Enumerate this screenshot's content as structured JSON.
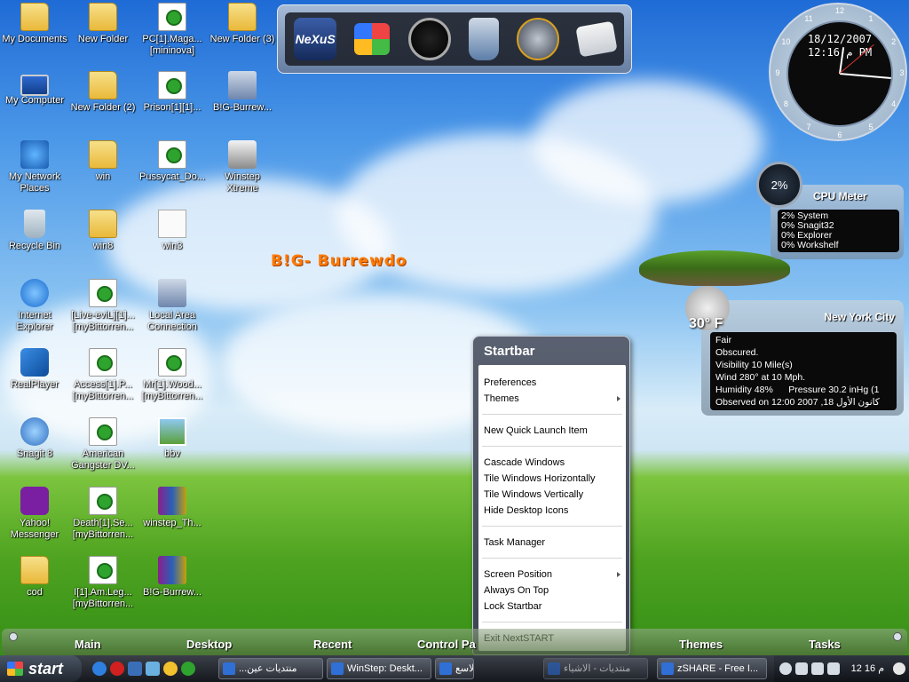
{
  "desktop": {
    "icons": [
      {
        "label": "My Documents",
        "icon": "folder-icon"
      },
      {
        "label": "New Folder",
        "icon": "folder-icon"
      },
      {
        "label": "PC[1].Maga...\n[mininova]",
        "icon": "torrent-file-icon"
      },
      {
        "label": "New Folder (3)",
        "icon": "folder-icon"
      },
      {
        "label": "My Computer",
        "icon": "computer-icon"
      },
      {
        "label": "New Folder (2)",
        "icon": "folder-icon"
      },
      {
        "label": "Prison[1][1]...",
        "icon": "torrent-file-icon"
      },
      {
        "label": "B!G-Burrew...",
        "icon": "installer-icon"
      },
      {
        "label": "My Network\nPlaces",
        "icon": "network-icon"
      },
      {
        "label": "win",
        "icon": "folder-icon"
      },
      {
        "label": "Pussycat_Do...",
        "icon": "torrent-file-icon"
      },
      {
        "label": "Winstep\nXtreme",
        "icon": "winstep-icon"
      },
      {
        "label": "Recycle Bin",
        "icon": "recycle-bin-icon"
      },
      {
        "label": "win8",
        "icon": "folder-icon"
      },
      {
        "label": "win3",
        "icon": "text-file-icon"
      },
      {
        "label": "Internet\nExplorer",
        "icon": "internet-explorer-icon"
      },
      {
        "label": "[Live-eviL][1]...\n[myBittorren...",
        "icon": "torrent-file-icon"
      },
      {
        "label": "Local Area\nConnection",
        "icon": "network-connection-icon"
      },
      {
        "label": "RealPlayer",
        "icon": "realplayer-icon"
      },
      {
        "label": "Access[1].P...\n[myBittorren...",
        "icon": "torrent-file-icon"
      },
      {
        "label": "Mr[1].Wood...\n[myBittorren...",
        "icon": "torrent-file-icon"
      },
      {
        "label": "Snagit 8",
        "icon": "snagit-icon"
      },
      {
        "label": "American\nGangster DV...",
        "icon": "torrent-file-icon"
      },
      {
        "label": "bbv",
        "icon": "image-file-icon"
      },
      {
        "label": "Yahoo!\nMessenger",
        "icon": "yahoo-messenger-icon"
      },
      {
        "label": "Death[1].Se...\n[myBittorren...",
        "icon": "torrent-file-icon"
      },
      {
        "label": "winstep_Th...",
        "icon": "rar-archive-icon"
      },
      {
        "label": "cod",
        "icon": "folder-icon"
      },
      {
        "label": "I[1].Am.Leg...\n[myBittorren...",
        "icon": "torrent-file-icon"
      },
      {
        "label": "B!G-Burrew...",
        "icon": "rar-archive-icon"
      }
    ],
    "overlay_text": "B!G- Burrewdo"
  },
  "dock": {
    "items": [
      {
        "label": "NeXuS",
        "icon": "nexus-logo-icon"
      },
      {
        "label": "",
        "icon": "windows-logo-icon"
      },
      {
        "label": "",
        "icon": "clock-icon"
      },
      {
        "label": "",
        "icon": "recycle-bin-icon"
      },
      {
        "label": "",
        "icon": "globe-icon"
      },
      {
        "label": "",
        "icon": "mail-icon"
      }
    ]
  },
  "clock_widget": {
    "date": "18/12/2007",
    "time": "12:16 م PM",
    "numbers": [
      "12",
      "1",
      "2",
      "3",
      "4",
      "5",
      "6",
      "7",
      "8",
      "9",
      "10",
      "11"
    ]
  },
  "cpu_meter": {
    "title": "CPU Meter",
    "usage": "2%",
    "usage_value": 2,
    "processes": [
      "2% System",
      "0% Snagit32",
      "0% Explorer",
      "0% Workshelf"
    ]
  },
  "weather": {
    "temperature": "30° F",
    "city": "New York City",
    "lines": [
      "Fair",
      "Obscured.",
      "Visibility 10 Mile(s)",
      "Wind 280° at 10 Mph.",
      "Humidity 48%      Pressure 30.2 inHg (1",
      "Observed on 12:00 2007 ,18 كانون الأول"
    ]
  },
  "startbar_menu": {
    "title": "Startbar",
    "groups": [
      [
        {
          "label": "Preferences",
          "submenu": false
        },
        {
          "label": "Themes",
          "submenu": true
        }
      ],
      [
        {
          "label": "New Quick Launch Item",
          "submenu": false
        }
      ],
      [
        {
          "label": "Cascade Windows",
          "submenu": false
        },
        {
          "label": "Tile Windows Horizontally",
          "submenu": false
        },
        {
          "label": "Tile Windows Vertically",
          "submenu": false
        },
        {
          "label": "Hide Desktop Icons",
          "submenu": false
        }
      ],
      [
        {
          "label": "Task Manager",
          "submenu": false
        }
      ],
      [
        {
          "label": "Screen Position",
          "submenu": true
        },
        {
          "label": "Always On Top",
          "submenu": false
        },
        {
          "label": "Lock Startbar",
          "submenu": false
        }
      ],
      [
        {
          "label": "Exit NextSTART",
          "submenu": false
        }
      ]
    ]
  },
  "startbar_strip": {
    "tabs": [
      "Main",
      "Desktop",
      "Recent",
      "Control Pa",
      "Themes",
      "Tasks"
    ]
  },
  "taskbar": {
    "start_label": "start",
    "tasks": [
      "...منتديات عين",
      "WinStep: Deskt...",
      "منتدى الاسع...",
      "منتديات - الاشياء",
      "zSHARE - Free I..."
    ],
    "clock": "12 16 م"
  }
}
